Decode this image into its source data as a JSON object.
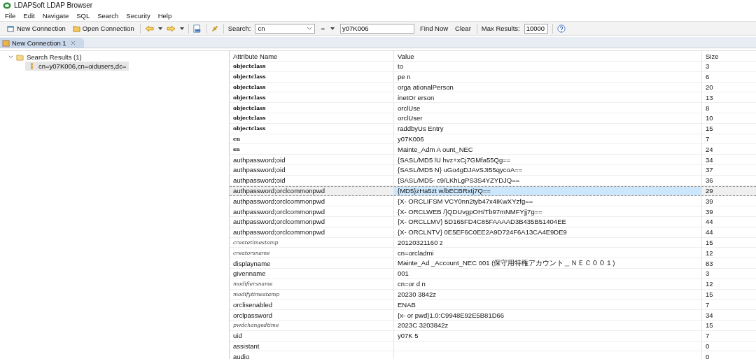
{
  "window": {
    "title": "LDAPSoft LDAP Browser"
  },
  "menu": [
    "File",
    "Edit",
    "Navigate",
    "SQL",
    "Search",
    "Security",
    "Help"
  ],
  "toolbar": {
    "new_connection": "New Connection",
    "open_connection": "Open Connection",
    "search_label": "Search:",
    "search_attribute": "cn",
    "operator": "=",
    "search_value": "y07K006",
    "find_now": "Find Now",
    "clear": "Clear",
    "max_results_label": "Max Results:",
    "max_results": "10000"
  },
  "tabs": [
    {
      "label": "New Connection 1",
      "selected": true
    }
  ],
  "tree": {
    "label": "Search Results (1)",
    "expanded": true,
    "children": [
      {
        "label": "cn=y07K006,cn=oidusers,dc=",
        "selected": true
      }
    ]
  },
  "table": {
    "columns": [
      "Attribute Name",
      "Value",
      "Size"
    ],
    "rows": [
      {
        "kind": "bold",
        "name": "objectclass",
        "value": "to",
        "size": "3",
        "selected": false
      },
      {
        "kind": "bold",
        "name": "objectclass",
        "value": "pe    n",
        "size": "6",
        "selected": false
      },
      {
        "kind": "bold",
        "name": "objectclass",
        "value": "orga      ationalPerson",
        "size": "20",
        "selected": false
      },
      {
        "kind": "bold",
        "name": "objectclass",
        "value": "inetOr    erson",
        "size": "13",
        "selected": false
      },
      {
        "kind": "bold",
        "name": "objectclass",
        "value": "orclUse",
        "size": "8",
        "selected": false
      },
      {
        "kind": "bold",
        "name": "objectclass",
        "value": "orclUser",
        "size": "10",
        "selected": false
      },
      {
        "kind": "bold",
        "name": "objectclass",
        "value": "raddbyUs     Entry",
        "size": "15",
        "selected": false
      },
      {
        "kind": "bold",
        "name": "cn",
        "value": "y07K006",
        "size": "7",
        "selected": false
      },
      {
        "kind": "bold",
        "name": "sn",
        "value": "Mainte_Adm    A    ount_NEC",
        "size": "24",
        "selected": false
      },
      {
        "kind": "plain",
        "name": "authpassword;oid",
        "value": "{SASL/MD5    lU    hvz+xCj7GMfa55Qg==",
        "size": "34",
        "selected": false
      },
      {
        "kind": "plain",
        "name": "authpassword;oid",
        "value": "{SASL/MD5    N}    uGo4gDJAvSJI55qycoA==",
        "size": "37",
        "selected": false
      },
      {
        "kind": "plain",
        "name": "authpassword;oid",
        "value": "{SASL/MD5-    c9/LKhLgPS3S4YZYDJQ==",
        "size": "36",
        "selected": false
      },
      {
        "kind": "plain",
        "name": "authpassword;orclcommonpwd",
        "value": "{MD5}zHa5zt       w/bECBRxtj7Q==",
        "size": "29",
        "selected": true
      },
      {
        "kind": "plain",
        "name": "authpassword;orclcommonpwd",
        "value": "{X- ORCLIFSM      VCY0nn2tyb47x4IKwXYzfg==",
        "size": "39",
        "selected": false
      },
      {
        "kind": "plain",
        "name": "authpassword;orclcommonpwd",
        "value": "{X- ORCLWEB     /}QDUvgpOH/Tb97mNMFYjj7g==",
        "size": "39",
        "selected": false
      },
      {
        "kind": "plain",
        "name": "authpassword;orclcommonpwd",
        "value": "{X- ORCLLMV}    5D165FD4C85FAAAAD3B435B51404EE",
        "size": "44",
        "selected": false
      },
      {
        "kind": "plain",
        "name": "authpassword;orclcommonpwd",
        "value": "{X- ORCLNTV}    0E5EF6C0EE2A9D724F6A13CA4E9DE9",
        "size": "44",
        "selected": false
      },
      {
        "kind": "italic",
        "name": "createtimestamp",
        "value": "20120321160    z",
        "size": "15",
        "selected": false
      },
      {
        "kind": "italic",
        "name": "creatorsname",
        "value": "cn=orcladmi",
        "size": "12",
        "selected": false
      },
      {
        "kind": "plain",
        "name": "displayname",
        "value": "Mainte_Ad     _Account_NEC 001 (保守用特権アカウント＿ＮＥＣ００１)",
        "size": "83",
        "selected": false
      },
      {
        "kind": "plain",
        "name": "givenname",
        "value": "001",
        "size": "3",
        "selected": false
      },
      {
        "kind": "italic",
        "name": "modifiersname",
        "value": "cn=or     d    n",
        "size": "12",
        "selected": false
      },
      {
        "kind": "italic",
        "name": "modifytimestamp",
        "value": "20230     3842z",
        "size": "15",
        "selected": false
      },
      {
        "kind": "plain",
        "name": "orclisenabled",
        "value": "ENAB",
        "size": "7",
        "selected": false
      },
      {
        "kind": "plain",
        "name": "orclpassword",
        "value": "{x- or     pwd}1.0:C9948E92E5B81D66",
        "size": "34",
        "selected": false
      },
      {
        "kind": "italic",
        "name": "pwdchangedtime",
        "value": "2023C     3203842z",
        "size": "15",
        "selected": false
      },
      {
        "kind": "plain",
        "name": "uid",
        "value": "y07K    5",
        "size": "7",
        "selected": false
      },
      {
        "kind": "plain",
        "name": "assistant",
        "value": "",
        "size": "0",
        "selected": false
      },
      {
        "kind": "plain",
        "name": "audio",
        "value": "",
        "size": "0",
        "selected": false
      }
    ]
  }
}
